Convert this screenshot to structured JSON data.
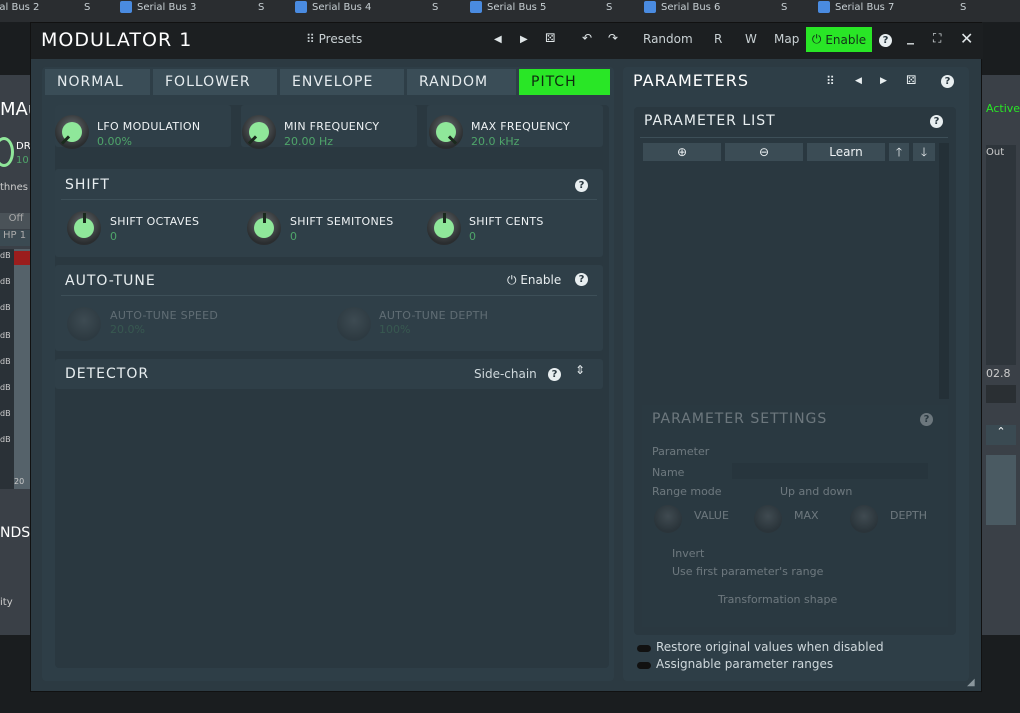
{
  "host": {
    "buses": [
      "Serial Bus 2",
      "Serial Bus 3",
      "Serial Bus 4",
      "Serial Bus 5",
      "Serial Bus 6",
      "Serial Bus 7"
    ]
  },
  "background_plugin": {
    "left_fragments": [
      "MAu",
      "DR",
      "10",
      "thnes",
      "Off",
      "HP 1",
      "dB",
      "dB",
      "dB",
      "dB",
      "dB",
      "dB",
      "dB",
      "dB",
      "20",
      "NDS",
      "ity"
    ],
    "right_fragments": [
      "Active",
      "Out",
      "02.8"
    ]
  },
  "window": {
    "title": "MODULATOR 1",
    "presets_label": "Presets",
    "random_label": "Random",
    "r_label": "R",
    "w_label": "W",
    "map_label": "Map",
    "enable_label": "Enable"
  },
  "tabs": [
    {
      "label": "NORMAL",
      "active": false
    },
    {
      "label": "FOLLOWER",
      "active": false
    },
    {
      "label": "ENVELOPE",
      "active": false
    },
    {
      "label": "RANDOM",
      "active": false
    },
    {
      "label": "PITCH",
      "active": true
    }
  ],
  "pitch": {
    "knobs_top": [
      {
        "label": "LFO MODULATION",
        "value": "0.00%"
      },
      {
        "label": "MIN FREQUENCY",
        "value": "20.00 Hz"
      },
      {
        "label": "MAX FREQUENCY",
        "value": "20.0 kHz"
      }
    ],
    "shift": {
      "title": "SHIFT",
      "knobs": [
        {
          "label": "SHIFT OCTAVES",
          "value": "0"
        },
        {
          "label": "SHIFT SEMITONES",
          "value": "0"
        },
        {
          "label": "SHIFT CENTS",
          "value": "0"
        }
      ]
    },
    "autotune": {
      "title": "AUTO-TUNE",
      "enable_label": "Enable",
      "knobs": [
        {
          "label": "AUTO-TUNE SPEED",
          "value": "20.0%"
        },
        {
          "label": "AUTO-TUNE DEPTH",
          "value": "100%"
        }
      ]
    },
    "detector": {
      "title": "DETECTOR",
      "sidechain_label": "Side-chain"
    }
  },
  "parameters": {
    "title": "PARAMETERS",
    "list_title": "PARAMETER LIST",
    "learn_label": "Learn",
    "settings": {
      "title": "PARAMETER SETTINGS",
      "parameter_label": "Parameter",
      "name_label": "Name",
      "range_mode_label": "Range mode",
      "range_mode_value": "Up and down",
      "value_label": "VALUE",
      "max_label": "MAX",
      "depth_label": "DEPTH",
      "invert_label": "Invert",
      "use_first_label": "Use first parameter's range",
      "transform_label": "Transformation shape"
    },
    "options": [
      "Restore original values when disabled",
      "Assignable parameter ranges"
    ]
  },
  "colors": {
    "accent_green": "#29e626",
    "knob_green": "#8fe79a",
    "value_green": "#4fa56a"
  }
}
